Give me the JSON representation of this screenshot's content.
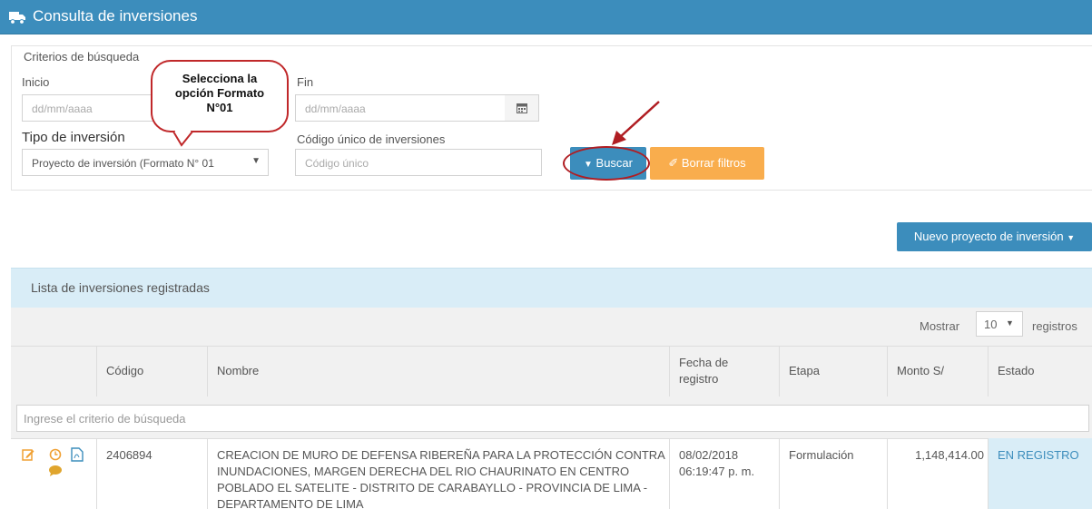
{
  "window": {
    "title": "Consulta de inversiones"
  },
  "filters": {
    "legend": "Criterios de búsqueda",
    "inicio": {
      "label": "Inicio",
      "placeholder": "dd/mm/aaaa"
    },
    "fin": {
      "label": "Fin",
      "placeholder": "dd/mm/aaaa"
    },
    "tipo": {
      "label": "Tipo de inversión",
      "value": "Proyecto de inversión (Formato N° 01"
    },
    "codigo": {
      "label": "Código único de inversiones",
      "placeholder": "Código único"
    },
    "buscar_label": "Buscar",
    "borrar_label": "Borrar filtros"
  },
  "callout": {
    "line1": "Selecciona la",
    "line2": "opción Formato",
    "line3": "N°01"
  },
  "nuevo_label": "Nuevo proyecto de inversión",
  "list": {
    "title": "Lista de inversiones registradas",
    "mostrar": "Mostrar",
    "page_size": "10",
    "registros": "registros",
    "columns": {
      "codigo": "Código",
      "nombre": "Nombre",
      "fecha1": "Fecha de",
      "fecha2": "registro",
      "etapa": "Etapa",
      "monto": "Monto S/",
      "estado": "Estado"
    },
    "search_placeholder": "Ingrese el criterio de búsqueda",
    "rows": [
      {
        "codigo": "2406894",
        "nombre_l1": "CREACION DE MURO DE DEFENSA RIBEREÑA PARA LA PROTECCIÓN CONTRA",
        "nombre_l2": "INUNDACIONES, MARGEN DERECHA DEL RIO CHAURINATO EN CENTRO",
        "nombre_l3": "POBLADO EL SATELITE - DISTRITO DE CARABAYLLO - PROVINCIA DE LIMA -",
        "nombre_l4": "DEPARTAMENTO DE LIMA",
        "fecha": "08/02/2018",
        "hora": "06:19:47 p. m.",
        "etapa": "Formulación",
        "monto": "1,148,414.00",
        "estado": "EN REGISTRO"
      }
    ]
  },
  "colors": {
    "primary": "#3c8dbc",
    "warning": "#f9ad4d",
    "annotation": "#c0282a",
    "info_bg": "#d9edf7"
  }
}
